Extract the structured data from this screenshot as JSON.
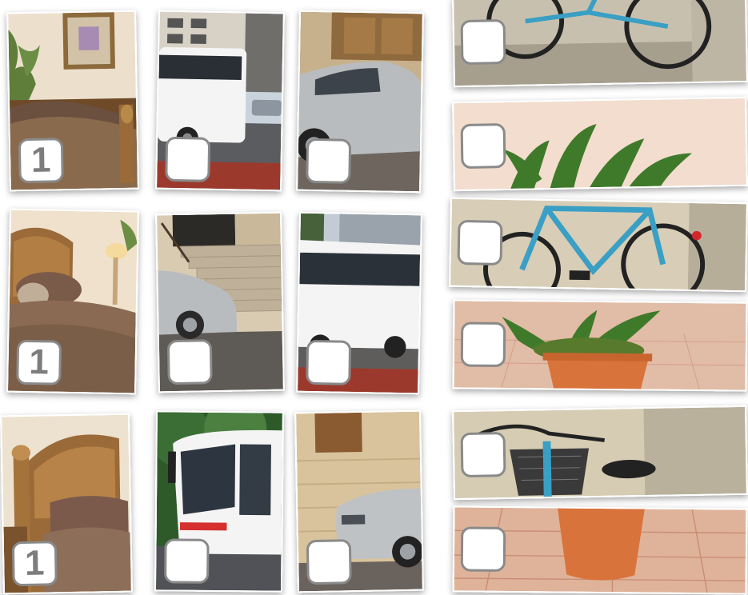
{
  "puzzle": {
    "tiles": [
      {
        "id": "bedroom-1",
        "subject": "bedroom",
        "box_value": "1"
      },
      {
        "id": "bus-1",
        "subject": "bus",
        "box_value": ""
      },
      {
        "id": "car-1",
        "subject": "car",
        "box_value": ""
      },
      {
        "id": "bedroom-2",
        "subject": "bedroom",
        "box_value": "1"
      },
      {
        "id": "car-2",
        "subject": "car",
        "box_value": ""
      },
      {
        "id": "bus-2",
        "subject": "bus",
        "box_value": ""
      },
      {
        "id": "bedroom-3",
        "subject": "bedroom",
        "box_value": "1"
      },
      {
        "id": "bus-3",
        "subject": "bus",
        "box_value": ""
      },
      {
        "id": "car-3",
        "subject": "car",
        "box_value": ""
      },
      {
        "id": "bicycle-1",
        "subject": "bicycle",
        "box_value": ""
      },
      {
        "id": "plant-1",
        "subject": "plant",
        "box_value": ""
      },
      {
        "id": "bicycle-2",
        "subject": "bicycle",
        "box_value": ""
      },
      {
        "id": "plant-2",
        "subject": "plant",
        "box_value": ""
      },
      {
        "id": "bicycle-3",
        "subject": "bicycle",
        "box_value": ""
      },
      {
        "id": "plant-3",
        "subject": "plant",
        "box_value": ""
      }
    ]
  },
  "colors": {
    "box_border": "#8a8a8a",
    "box_text": "#7d7d7d",
    "bus_white": "#f4f4f4",
    "car_silver": "#b9bcbf",
    "bike_blue": "#3a9fc4",
    "pot_terracotta": "#d9733c",
    "wood": "#9a6a38"
  }
}
